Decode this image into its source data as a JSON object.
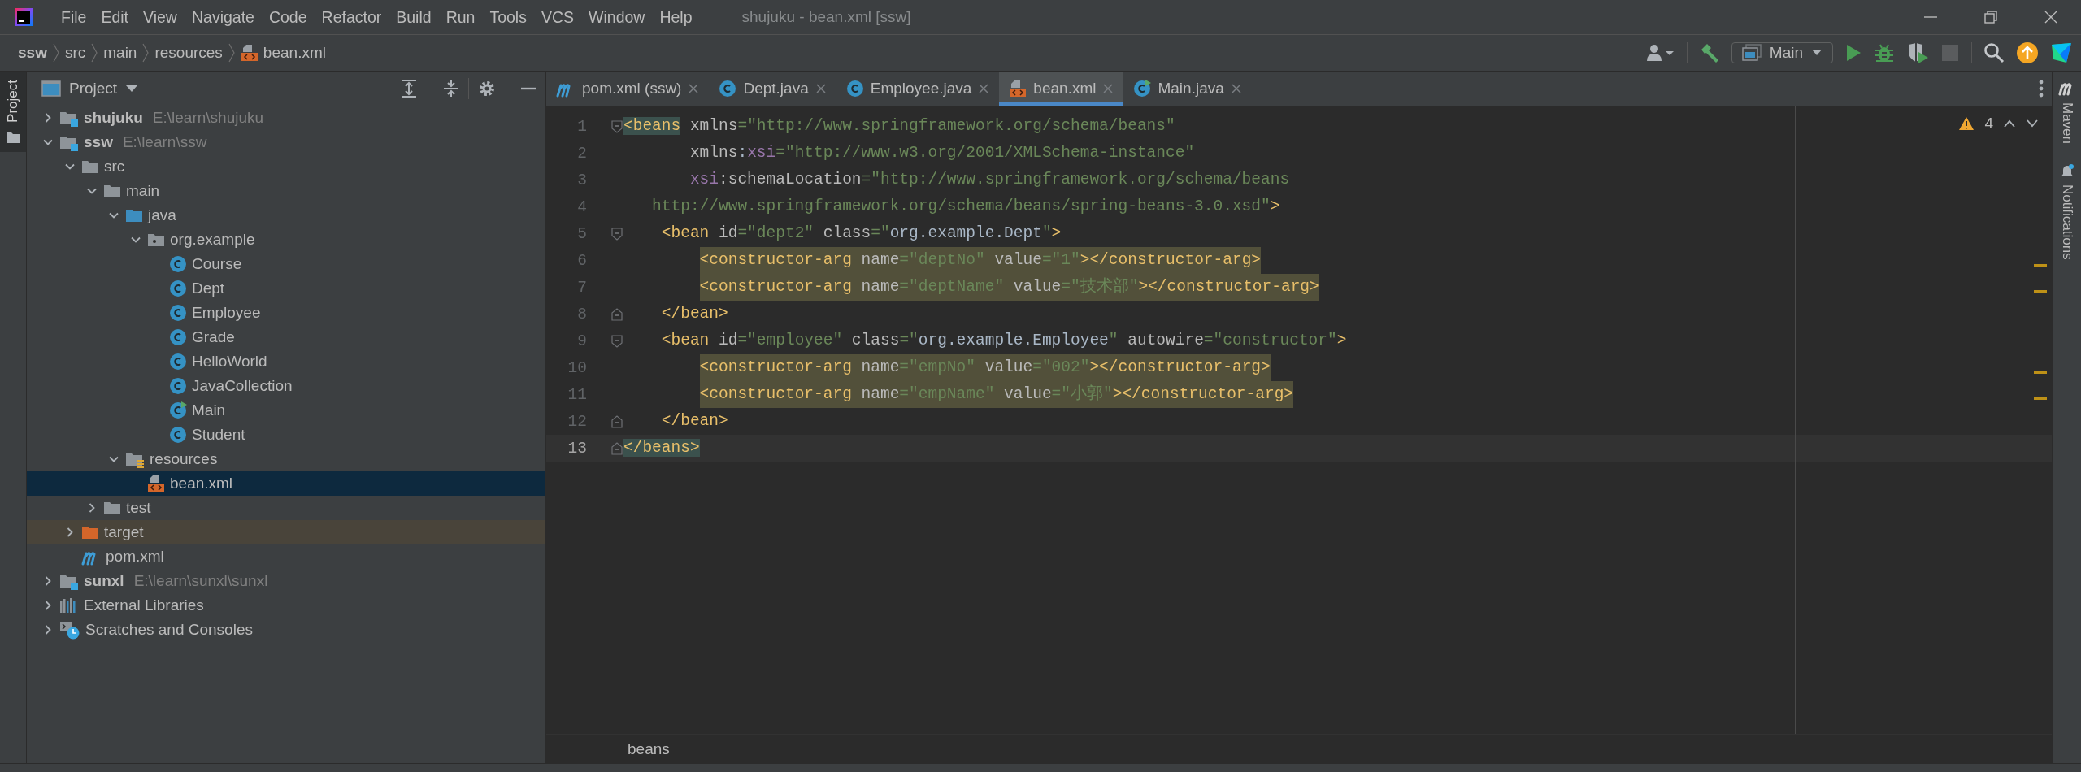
{
  "window": {
    "title": "shujuku - bean.xml [ssw]"
  },
  "menu": [
    "File",
    "Edit",
    "View",
    "Navigate",
    "Code",
    "Refactor",
    "Build",
    "Run",
    "Tools",
    "VCS",
    "Window",
    "Help"
  ],
  "breadcrumbs": [
    {
      "label": "ssw",
      "kind": "module"
    },
    {
      "label": "src",
      "kind": "folder"
    },
    {
      "label": "main",
      "kind": "folder"
    },
    {
      "label": "resources",
      "kind": "folder"
    },
    {
      "label": "bean.xml",
      "kind": "xml"
    }
  ],
  "toolbar": {
    "run_configuration": "Main"
  },
  "side_tabs": {
    "left": [
      {
        "label": "Project",
        "selected": true
      }
    ],
    "right": [
      {
        "label": "Maven",
        "kind": "maven"
      },
      {
        "label": "Notifications",
        "kind": "bell"
      }
    ]
  },
  "project_panel": {
    "title": "Project",
    "tree": [
      {
        "label": "shujuku",
        "path": "E:\\learn\\shujuku",
        "kind": "module",
        "expanded": false,
        "selected": false
      },
      {
        "label": "ssw",
        "path": "E:\\learn\\ssw",
        "kind": "module",
        "expanded": true,
        "selected": false,
        "children": [
          {
            "label": "src",
            "kind": "folder",
            "expanded": true,
            "selected": false,
            "children": [
              {
                "label": "main",
                "kind": "folder",
                "expanded": true,
                "selected": false,
                "children": [
                  {
                    "label": "java",
                    "kind": "source-folder",
                    "expanded": true,
                    "selected": false,
                    "children": [
                      {
                        "label": "org.example",
                        "kind": "package",
                        "expanded": true,
                        "selected": false,
                        "children": [
                          {
                            "label": "Course",
                            "kind": "class",
                            "selected": false
                          },
                          {
                            "label": "Dept",
                            "kind": "class",
                            "selected": false
                          },
                          {
                            "label": "Employee",
                            "kind": "class",
                            "selected": false
                          },
                          {
                            "label": "Grade",
                            "kind": "class",
                            "selected": false
                          },
                          {
                            "label": "HelloWorld",
                            "kind": "class",
                            "selected": false
                          },
                          {
                            "label": "JavaCollection",
                            "kind": "class",
                            "selected": false
                          },
                          {
                            "label": "Main",
                            "kind": "main-class",
                            "selected": false
                          },
                          {
                            "label": "Student",
                            "kind": "class",
                            "selected": false
                          }
                        ]
                      }
                    ]
                  },
                  {
                    "label": "resources",
                    "kind": "resources",
                    "expanded": true,
                    "selected": false,
                    "children": [
                      {
                        "label": "bean.xml",
                        "kind": "xml",
                        "selected": true
                      }
                    ]
                  }
                ]
              },
              {
                "label": "test",
                "kind": "folder",
                "expanded": false,
                "selected": false
              }
            ]
          },
          {
            "label": "target",
            "kind": "excluded-folder",
            "expanded": false,
            "selected": false
          },
          {
            "label": "pom.xml",
            "kind": "maven",
            "selected": false
          }
        ]
      },
      {
        "label": "sunxl",
        "path": "E:\\learn\\sunxl\\sunxl",
        "kind": "module",
        "expanded": false,
        "selected": false
      },
      {
        "label": "External Libraries",
        "kind": "libraries",
        "expanded": false,
        "selected": false
      },
      {
        "label": "Scratches and Consoles",
        "kind": "scratches",
        "expanded": false,
        "selected": false
      }
    ]
  },
  "editor": {
    "tabs": [
      {
        "label": "pom.xml (ssw)",
        "kind": "maven",
        "selected": false
      },
      {
        "label": "Dept.java",
        "kind": "class",
        "selected": false
      },
      {
        "label": "Employee.java",
        "kind": "class",
        "selected": false
      },
      {
        "label": "bean.xml",
        "kind": "xml",
        "selected": true
      },
      {
        "label": "Main.java",
        "kind": "main-class",
        "selected": false
      }
    ],
    "warnings": "4",
    "lines": [
      {
        "number": "1",
        "kind": "root",
        "fold_start": true,
        "fold_end": false,
        "highlighted": false,
        "current": false,
        "spans": [
          {
            "kind": "tag-match",
            "text": "<beans"
          },
          {
            "kind": "attr",
            "text": " xmlns"
          },
          {
            "kind": "value",
            "text": "=\"http://www.springframework.org/schema/beans\""
          }
        ]
      },
      {
        "number": "2",
        "kind": "attribute",
        "fold_start": false,
        "fold_end": false,
        "highlighted": false,
        "current": false,
        "spans": [
          {
            "kind": "attr",
            "text": "xmlns"
          },
          {
            "kind": "plain",
            "text": ":"
          },
          {
            "kind": "ns",
            "text": "xsi"
          },
          {
            "kind": "value",
            "text": "=\"http://www.w3.org/2001/XMLSchema-instance\""
          }
        ]
      },
      {
        "number": "3",
        "kind": "attribute",
        "fold_start": false,
        "fold_end": false,
        "highlighted": false,
        "current": false,
        "spans": [
          {
            "kind": "ns",
            "text": "xsi"
          },
          {
            "kind": "attr",
            "text": ":schemaLocation"
          },
          {
            "kind": "value",
            "text": "=\"http://www.springframework.org/schema/beans"
          }
        ]
      },
      {
        "number": "4",
        "kind": "wrapped",
        "fold_start": false,
        "fold_end": false,
        "highlighted": false,
        "current": false,
        "spans": [
          {
            "kind": "value",
            "text": "http://www.springframework.org/schema/beans/spring-beans-3.0.xsd\""
          },
          {
            "kind": "tag",
            "text": ">"
          }
        ]
      },
      {
        "number": "5",
        "kind": "bean",
        "fold_start": true,
        "fold_end": false,
        "highlighted": false,
        "current": false,
        "spans": [
          {
            "kind": "tag",
            "text": "<bean"
          },
          {
            "kind": "attr",
            "text": " id"
          },
          {
            "kind": "value",
            "text": "=\"dept2\""
          },
          {
            "kind": "attr",
            "text": " class"
          },
          {
            "kind": "value",
            "text": "=\""
          },
          {
            "kind": "ref",
            "text": "org.example.Dept"
          },
          {
            "kind": "value",
            "text": "\""
          },
          {
            "kind": "tag",
            "text": ">"
          }
        ]
      },
      {
        "number": "6",
        "kind": "argument",
        "fold_start": false,
        "fold_end": false,
        "highlighted": true,
        "current": false,
        "spans": [
          {
            "kind": "tag",
            "text": "<constructor-arg"
          },
          {
            "kind": "attr",
            "text": " name"
          },
          {
            "kind": "value",
            "text": "=\"deptNo\""
          },
          {
            "kind": "attr",
            "text": " value"
          },
          {
            "kind": "value",
            "text": "=\"1\""
          },
          {
            "kind": "tag",
            "text": "></constructor-arg>"
          }
        ]
      },
      {
        "number": "7",
        "kind": "argument",
        "fold_start": false,
        "fold_end": false,
        "highlighted": true,
        "current": false,
        "spans": [
          {
            "kind": "tag",
            "text": "<constructor-arg"
          },
          {
            "kind": "attr",
            "text": " name"
          },
          {
            "kind": "value",
            "text": "=\"deptName\""
          },
          {
            "kind": "attr",
            "text": " value"
          },
          {
            "kind": "value",
            "text": "=\"技术部\""
          },
          {
            "kind": "tag",
            "text": "></constructor-arg>"
          }
        ]
      },
      {
        "number": "8",
        "kind": "bean",
        "fold_start": false,
        "fold_end": true,
        "highlighted": false,
        "current": false,
        "spans": [
          {
            "kind": "tag",
            "text": "</bean>"
          }
        ]
      },
      {
        "number": "9",
        "kind": "bean",
        "fold_start": true,
        "fold_end": false,
        "highlighted": false,
        "current": false,
        "spans": [
          {
            "kind": "tag",
            "text": "<bean"
          },
          {
            "kind": "attr",
            "text": " id"
          },
          {
            "kind": "value",
            "text": "=\"employee\""
          },
          {
            "kind": "attr",
            "text": " class"
          },
          {
            "kind": "value",
            "text": "=\""
          },
          {
            "kind": "ref",
            "text": "org.example.Employee"
          },
          {
            "kind": "value",
            "text": "\""
          },
          {
            "kind": "attr",
            "text": " autowire"
          },
          {
            "kind": "value",
            "text": "=\"constructor\""
          },
          {
            "kind": "tag",
            "text": ">"
          }
        ]
      },
      {
        "number": "10",
        "kind": "argument",
        "fold_start": false,
        "fold_end": false,
        "highlighted": true,
        "current": false,
        "spans": [
          {
            "kind": "tag",
            "text": "<constructor-arg"
          },
          {
            "kind": "attr",
            "text": " name"
          },
          {
            "kind": "value",
            "text": "=\"empNo\""
          },
          {
            "kind": "attr",
            "text": " value"
          },
          {
            "kind": "value",
            "text": "=\"002\""
          },
          {
            "kind": "tag",
            "text": "></constructor-arg>"
          }
        ]
      },
      {
        "number": "11",
        "kind": "argument",
        "fold_start": false,
        "fold_end": false,
        "highlighted": true,
        "current": false,
        "spans": [
          {
            "kind": "tag",
            "text": "<constructor-arg"
          },
          {
            "kind": "attr",
            "text": " name"
          },
          {
            "kind": "value",
            "text": "=\"empName\""
          },
          {
            "kind": "attr",
            "text": " value"
          },
          {
            "kind": "value",
            "text": "=\"小郭\""
          },
          {
            "kind": "tag",
            "text": "></constructor-arg>"
          }
        ]
      },
      {
        "number": "12",
        "kind": "bean",
        "fold_start": false,
        "fold_end": true,
        "highlighted": false,
        "current": false,
        "spans": [
          {
            "kind": "tag",
            "text": "</bean>"
          }
        ]
      },
      {
        "number": "13",
        "kind": "root",
        "fold_start": false,
        "fold_end": true,
        "highlighted": false,
        "current": true,
        "spans": [
          {
            "kind": "tag-match",
            "text": "</beans>"
          }
        ]
      }
    ],
    "breadcrumb": "beans"
  }
}
